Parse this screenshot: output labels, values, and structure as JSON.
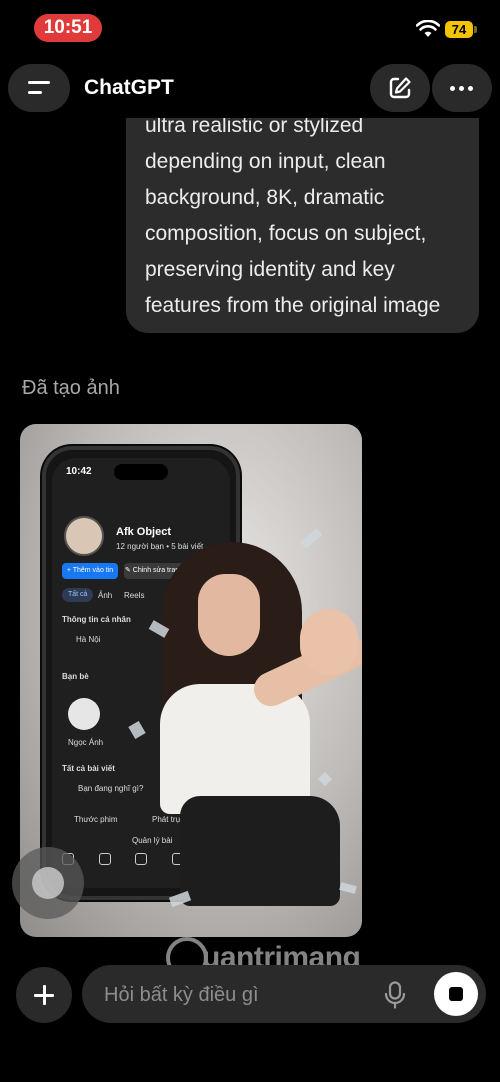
{
  "status_bar": {
    "time": "10:51",
    "battery": "74"
  },
  "header": {
    "title": "ChatGPT"
  },
  "message": {
    "lines": [
      "ultra realistic or stylized",
      "depending on input, clean",
      "background, 8K, dramatic",
      "composition, focus on subject,",
      "preserving identity and key",
      "features from the original image"
    ]
  },
  "caption": "Đã tạo ảnh",
  "generated_image": {
    "phone_time": "10:42",
    "profile_name": "Afk Object",
    "profile_meta": "12 người bạn • 5 bài viết",
    "btn_add_story": "+ Thêm vào tin",
    "btn_edit": "✎ Chỉnh sửa trang",
    "tabs": [
      "Tất cả",
      "Ảnh",
      "Reels"
    ],
    "info_title": "Thông tin cá nhân",
    "location": "Hà Nội",
    "friends_title": "Bạn bè",
    "friend_name": "Ngọc Ánh",
    "posts_title": "Tất cả bài viết",
    "compose_hint": "Bạn đang nghĩ gì?",
    "chip_photo": "Thước phim",
    "chip_live": "Phát trực",
    "manage_posts": "Quản lý bài"
  },
  "composer": {
    "placeholder": "Hỏi bất kỳ điều gì"
  },
  "watermark": {
    "text": "uantrimang"
  }
}
